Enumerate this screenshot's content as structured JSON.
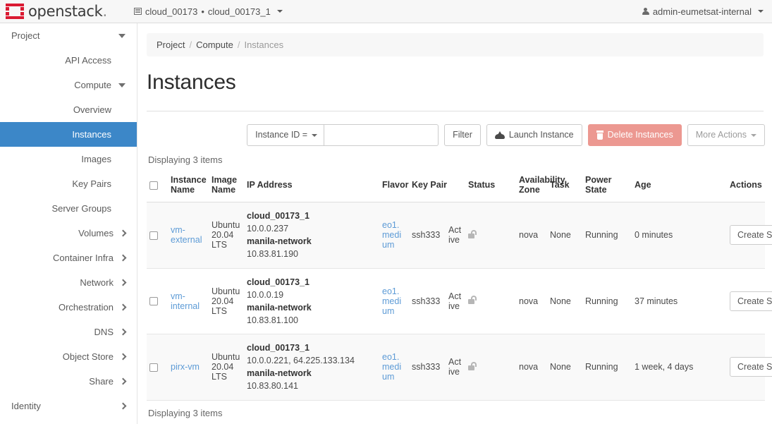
{
  "navbar": {
    "brand": "openstack",
    "brand_suffix": ".",
    "context_project": "cloud_00173",
    "context_separator": "•",
    "context_sub": "cloud_00173_1",
    "user": "admin-eumetsat-internal"
  },
  "sidebar": {
    "items": [
      {
        "label": "Project",
        "level": "top",
        "chevron": "down",
        "active": false
      },
      {
        "label": "API Access",
        "level": "child",
        "chevron": "none",
        "active": false
      },
      {
        "label": "Compute",
        "level": "child",
        "chevron": "down",
        "active": false
      },
      {
        "label": "Overview",
        "level": "child",
        "chevron": "none",
        "active": false
      },
      {
        "label": "Instances",
        "level": "child",
        "chevron": "none",
        "active": true
      },
      {
        "label": "Images",
        "level": "child",
        "chevron": "none",
        "active": false
      },
      {
        "label": "Key Pairs",
        "level": "child",
        "chevron": "none",
        "active": false
      },
      {
        "label": "Server Groups",
        "level": "child",
        "chevron": "none",
        "active": false
      },
      {
        "label": "Volumes",
        "level": "child",
        "chevron": "right",
        "active": false
      },
      {
        "label": "Container Infra",
        "level": "child",
        "chevron": "right",
        "active": false
      },
      {
        "label": "Network",
        "level": "child",
        "chevron": "right",
        "active": false
      },
      {
        "label": "Orchestration",
        "level": "child",
        "chevron": "right",
        "active": false
      },
      {
        "label": "DNS",
        "level": "child",
        "chevron": "right",
        "active": false
      },
      {
        "label": "Object Store",
        "level": "child",
        "chevron": "right",
        "active": false
      },
      {
        "label": "Share",
        "level": "child",
        "chevron": "right",
        "active": false
      },
      {
        "label": "Identity",
        "level": "top",
        "chevron": "right",
        "active": false
      }
    ],
    "active_color": "#3c87c8"
  },
  "breadcrumb": {
    "items": [
      "Project",
      "Compute",
      "Instances"
    ],
    "separator": "/"
  },
  "page": {
    "title": "Instances"
  },
  "toolbar": {
    "filter_select": "Instance ID =",
    "filter_placeholder": "",
    "filter_value": "",
    "filter_button": "Filter",
    "launch_button": "Launch Instance",
    "delete_button": "Delete Instances",
    "delete_button_color": "#ec9891",
    "more_actions_button": "More Actions"
  },
  "table": {
    "count_top": "Displaying 3 items",
    "count_bottom": "Displaying 3 items",
    "headers": [
      "",
      "Instance Name",
      "Image Name",
      "IP Address",
      "Flavor",
      "Key Pair",
      "Status",
      "Availability Zone",
      "Task",
      "Power State",
      "Age",
      "Actions"
    ],
    "rows": [
      {
        "instance_name": "vm-external",
        "image_name": "Ubuntu 20.04 LTS",
        "ip_net1": "cloud_00173_1",
        "ip_addr1": "10.0.0.237",
        "ip_net2": "manila-network",
        "ip_addr2": "10.83.81.190",
        "flavor": "eo1.medium",
        "key_pair": "ssh333",
        "status": "Active",
        "lock_icon": "unlock-icon",
        "availability_zone": "nova",
        "task": "None",
        "power_state": "Running",
        "age": "0 minutes",
        "action": "Create Snapshot"
      },
      {
        "instance_name": "vm-internal",
        "image_name": "Ubuntu 20.04 LTS",
        "ip_net1": "cloud_00173_1",
        "ip_addr1": "10.0.0.19",
        "ip_net2": "manila-network",
        "ip_addr2": "10.83.81.100",
        "flavor": "eo1.medium",
        "key_pair": "ssh333",
        "status": "Active",
        "lock_icon": "unlock-icon",
        "availability_zone": "nova",
        "task": "None",
        "power_state": "Running",
        "age": "37 minutes",
        "action": "Create Snapshot"
      },
      {
        "instance_name": "pirx-vm",
        "image_name": "Ubuntu 20.04 LTS",
        "ip_net1": "cloud_00173_1",
        "ip_addr1": "10.0.0.221, 64.225.133.134",
        "ip_net2": "manila-network",
        "ip_addr2": "10.83.80.141",
        "flavor": "eo1.medium",
        "key_pair": "ssh333",
        "status": "Active",
        "lock_icon": "unlock-icon",
        "availability_zone": "nova",
        "task": "None",
        "power_state": "Running",
        "age": "1 week, 4 days",
        "action": "Create Snapshot"
      }
    ]
  }
}
